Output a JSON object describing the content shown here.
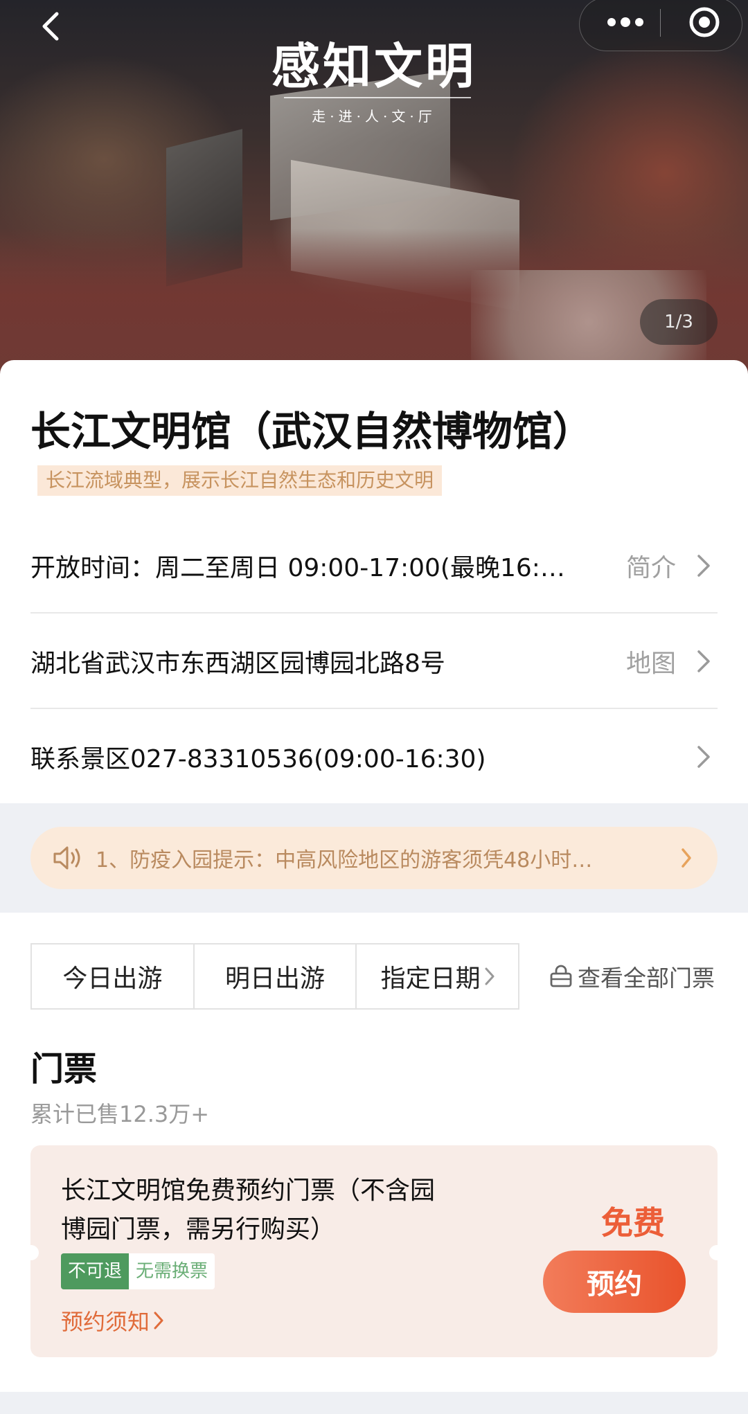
{
  "hero": {
    "title": "感知文明",
    "subtitle": "走·进·人·文·厅",
    "pager": "1/3"
  },
  "venue": {
    "name": "长江文明馆（武汉自然博物馆）",
    "tagline": "长江流域典型，展示长江自然生态和历史文明"
  },
  "info_rows": {
    "hours": {
      "text": "开放时间：周二至周日 09:00-17:00(最晚16:…",
      "action": "简介"
    },
    "address": {
      "text": "湖北省武汉市东西湖区园博园北路8号",
      "action": "地图"
    },
    "contact": {
      "text": "联系景区027-83310536(09:00-16:30)"
    }
  },
  "notice": {
    "text": "1、防疫入园提示：中高风险地区的游客须凭48小时…"
  },
  "date_tabs": [
    "今日出游",
    "明日出游",
    "指定日期"
  ],
  "all_tickets_label": "查看全部门票",
  "section": {
    "title": "门票",
    "sold": "累计已售12.3万+"
  },
  "ticket": {
    "name": "长江文明馆免费预约门票（不含园博园门票，需另行购买）",
    "badge_refund": "不可退",
    "badge_exchange": "无需换票",
    "notice_link": "预约须知",
    "price": "免费",
    "book_label": "预约"
  },
  "colors": {
    "accent": "#ec5e38",
    "tag_bg": "#fbe8d8",
    "tag_text": "#c7935f",
    "green_badge": "#4e9a5e"
  },
  "icons": [
    "back-arrow-icon",
    "more-dots-icon",
    "target-icon",
    "chevron-right-icon",
    "speaker-icon",
    "shopping-bag-icon"
  ]
}
